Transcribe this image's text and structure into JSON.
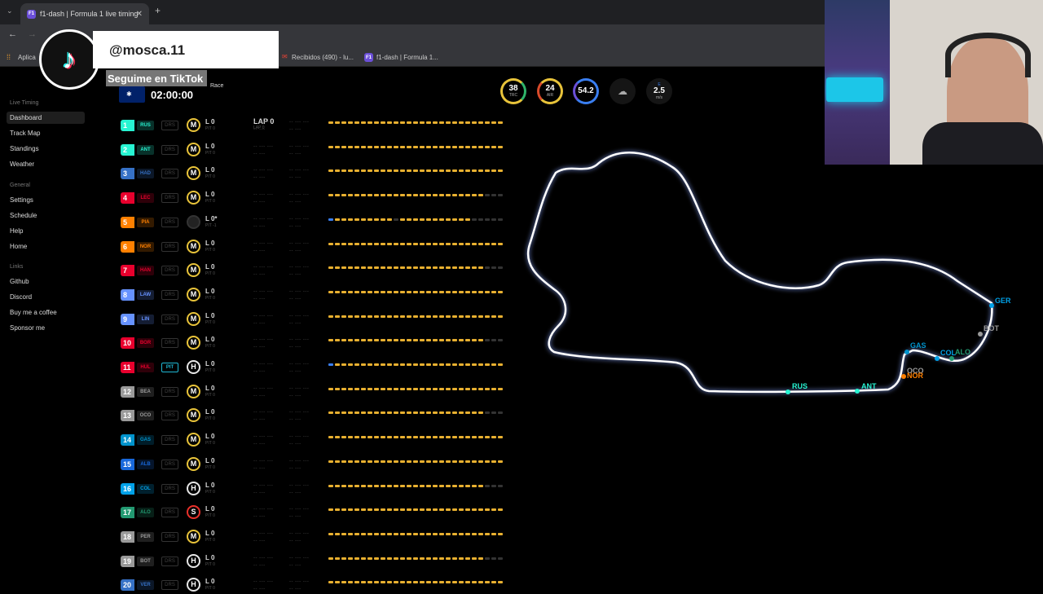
{
  "browser": {
    "tab_title": "f1-dash | Formula 1 live timing",
    "tab_favicon": "F1",
    "new_tab": "+",
    "bookmarks": [
      {
        "label": "Aplica",
        "icon": "apps-icon"
      },
      {
        "label": "Recibidos (490) - lu...",
        "icon": "gmail-icon"
      },
      {
        "label": "f1-dash | Formula 1...",
        "icon": "f1-icon"
      }
    ]
  },
  "overlay": {
    "handle": "@mosca.11",
    "follow_text": "Seguime en TikTok"
  },
  "controls": {
    "delay": "0"
  },
  "session": {
    "name_fragment": "Race",
    "clock": "02:00:00"
  },
  "weather": {
    "track": {
      "value": "38",
      "unit": "TRC"
    },
    "air": {
      "value": "24",
      "unit": "AIR"
    },
    "humidity": {
      "value": "54.2"
    },
    "condition_icon": "rain-cloud-icon",
    "wind": {
      "direction": "E",
      "value": "2.5",
      "unit": "m/s"
    }
  },
  "nav": {
    "live_timing": "Live Timing",
    "items1": [
      "Dashboard",
      "Track Map",
      "Standings",
      "Weather"
    ],
    "general": "General",
    "items2": [
      "Settings",
      "Schedule",
      "Help",
      "Home"
    ],
    "links": "Links",
    "items3": [
      "Github",
      "Discord",
      "Buy me a coffee",
      "Sponsor me"
    ]
  },
  "leader_lap": {
    "label": "LAP 0",
    "sub": "LAP 0"
  },
  "drivers": [
    {
      "pos": "1",
      "code": "RUS",
      "color": "#27f4d2",
      "drs": "DRS",
      "tyre": "M",
      "laps": "L 0",
      "pit": "PIT 0"
    },
    {
      "pos": "2",
      "code": "ANT",
      "color": "#27f4d2",
      "drs": "DRS",
      "tyre": "M",
      "laps": "L 0",
      "pit": "PIT 0"
    },
    {
      "pos": "3",
      "code": "HAD",
      "color": "#3671c6",
      "drs": "DRS",
      "tyre": "M",
      "laps": "L 0",
      "pit": "PIT 0"
    },
    {
      "pos": "4",
      "code": "LEC",
      "color": "#e8002d",
      "drs": "DRS",
      "tyre": "M",
      "laps": "L 0",
      "pit": "PIT 0"
    },
    {
      "pos": "5",
      "code": "PIA",
      "color": "#ff8000",
      "drs": "DRS",
      "tyre": "",
      "laps": "L 0*",
      "pit": "PIT -1"
    },
    {
      "pos": "6",
      "code": "NOR",
      "color": "#ff8000",
      "drs": "DRS",
      "tyre": "M",
      "laps": "L 0",
      "pit": "PIT 0"
    },
    {
      "pos": "7",
      "code": "HAN",
      "color": "#e8002d",
      "drs": "DRS",
      "tyre": "M",
      "laps": "L 0",
      "pit": "PIT 0"
    },
    {
      "pos": "8",
      "code": "LAW",
      "color": "#6692ff",
      "drs": "DRS",
      "tyre": "M",
      "laps": "L 0",
      "pit": "PIT 0"
    },
    {
      "pos": "9",
      "code": "LIN",
      "color": "#6692ff",
      "drs": "DRS",
      "tyre": "M",
      "laps": "L 0",
      "pit": "PIT 0"
    },
    {
      "pos": "10",
      "code": "BOR",
      "color": "#e8002d",
      "drs": "DRS",
      "tyre": "M",
      "laps": "L 0",
      "pit": "PIT 0"
    },
    {
      "pos": "11",
      "code": "HUL",
      "color": "#e8002d",
      "drs": "PIT",
      "tyre": "H",
      "laps": "L 0",
      "pit": "PIT 0"
    },
    {
      "pos": "12",
      "code": "BEA",
      "color": "#9a9a9a",
      "drs": "DRS",
      "tyre": "M",
      "laps": "L 0",
      "pit": "PIT 0"
    },
    {
      "pos": "13",
      "code": "OCO",
      "color": "#9a9a9a",
      "drs": "DRS",
      "tyre": "M",
      "laps": "L 0",
      "pit": "PIT 0"
    },
    {
      "pos": "14",
      "code": "GAS",
      "color": "#0093cc",
      "drs": "DRS",
      "tyre": "M",
      "laps": "L 0",
      "pit": "PIT 0"
    },
    {
      "pos": "15",
      "code": "ALB",
      "color": "#1868db",
      "drs": "DRS",
      "tyre": "M",
      "laps": "L 0",
      "pit": "PIT 0"
    },
    {
      "pos": "16",
      "code": "COL",
      "color": "#00a1e8",
      "drs": "DRS",
      "tyre": "H",
      "laps": "L 0",
      "pit": "PIT 0"
    },
    {
      "pos": "17",
      "code": "ALO",
      "color": "#229971",
      "drs": "DRS",
      "tyre": "S",
      "laps": "L 0",
      "pit": "PIT 0"
    },
    {
      "pos": "18",
      "code": "PER",
      "color": "#9a9a9a",
      "drs": "DRS",
      "tyre": "M",
      "laps": "L 0",
      "pit": "PIT 0"
    },
    {
      "pos": "19",
      "code": "BOT",
      "color": "#9a9a9a",
      "drs": "DRS",
      "tyre": "H",
      "laps": "L 0",
      "pit": "PIT 0"
    },
    {
      "pos": "20",
      "code": "VER",
      "color": "#3671c6",
      "drs": "DRS",
      "tyre": "H",
      "laps": "L 0",
      "pit": "PIT 0"
    }
  ],
  "map_labels": [
    {
      "code": "GER",
      "color": "#00a1e8"
    },
    {
      "code": "BOT",
      "color": "#9a9a9a"
    },
    {
      "code": "GAS",
      "color": "#0093cc"
    },
    {
      "code": "COL",
      "color": "#00a1e8"
    },
    {
      "code": "ALO",
      "color": "#229971"
    },
    {
      "code": "OCO",
      "color": "#9a9a9a"
    },
    {
      "code": "NOR",
      "color": "#ff8000"
    },
    {
      "code": "RUS",
      "color": "#27f4d2"
    },
    {
      "code": "ANT",
      "color": "#27f4d2"
    }
  ]
}
